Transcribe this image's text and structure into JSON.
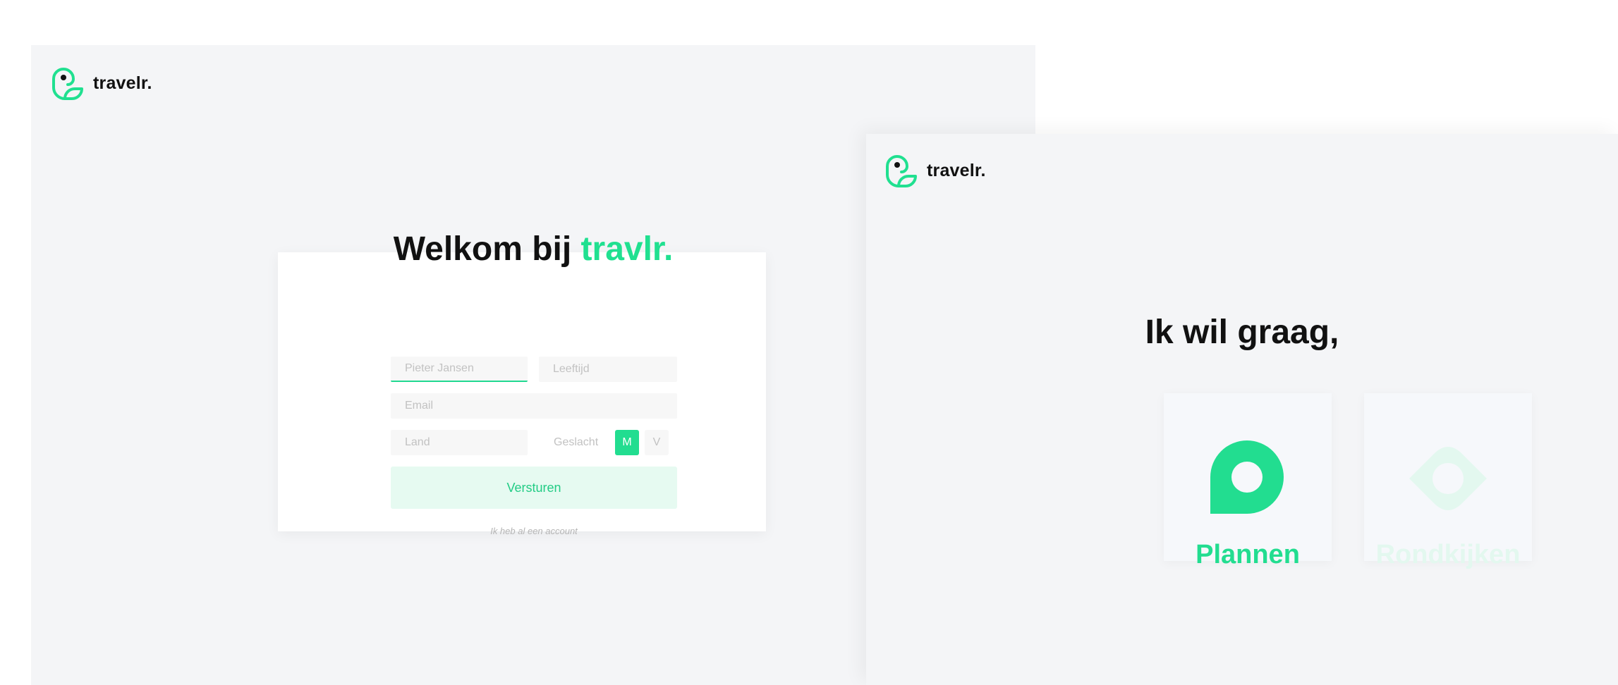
{
  "brand": {
    "name": "travelr.",
    "accent_color": "#20e090",
    "logo_icon": "bird-logo-icon"
  },
  "signup": {
    "title_prefix": "Welkom bij ",
    "title_accent": "travlr.",
    "name_placeholder": "Pieter Jansen",
    "age_placeholder": "Leeftijd",
    "email_placeholder": "Email",
    "country_placeholder": "Land",
    "gender_label": "Geslacht",
    "gender_options": [
      "M",
      "V"
    ],
    "gender_selected": "M",
    "submit_label": "Versturen",
    "account_link": "Ik heb al een account"
  },
  "choice": {
    "title": "Ik wil graag,",
    "options": [
      {
        "label": "Plannen",
        "icon": "map-pin-icon",
        "color": "#22dd90"
      },
      {
        "label": "Rondkijken",
        "icon": "eye-icon",
        "color": "#e3f8ef"
      }
    ]
  }
}
